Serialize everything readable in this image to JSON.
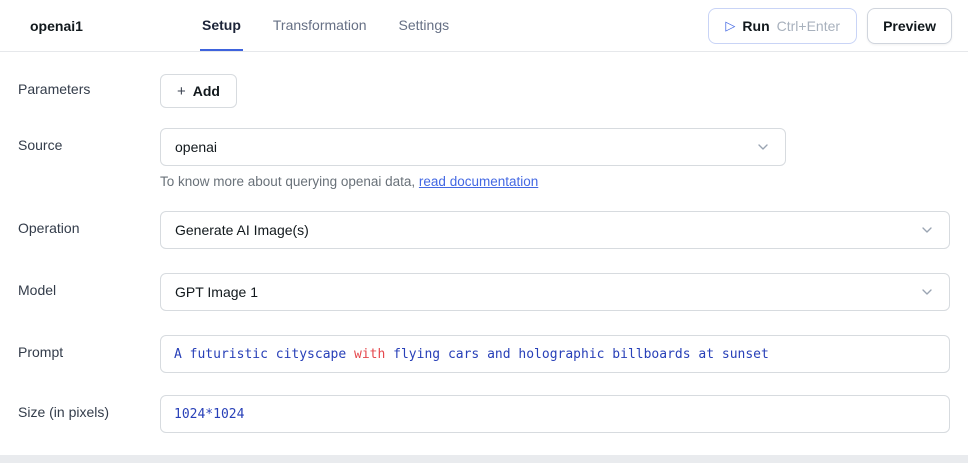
{
  "colors": {
    "accent": "#3e63dd",
    "link": "#4368e3",
    "code_blue": "#2840b8",
    "code_red": "#e5484d"
  },
  "header": {
    "query_name": "openai1",
    "tabs": [
      {
        "label": "Setup",
        "active": true
      },
      {
        "label": "Transformation",
        "active": false
      },
      {
        "label": "Settings",
        "active": false
      }
    ],
    "run_button": {
      "label": "Run",
      "shortcut": "Ctrl+Enter"
    },
    "preview_label": "Preview"
  },
  "form": {
    "parameters": {
      "label": "Parameters",
      "add_label": "Add"
    },
    "source": {
      "label": "Source",
      "value": "openai",
      "helper_prefix": "To know more about querying openai data, ",
      "helper_link": "read documentation"
    },
    "operation": {
      "label": "Operation",
      "value": "Generate AI Image(s)"
    },
    "model": {
      "label": "Model",
      "value": "GPT Image 1"
    },
    "prompt": {
      "label": "Prompt",
      "tokens": [
        {
          "text": "A futuristic cityscape ",
          "color": "blue"
        },
        {
          "text": "with",
          "color": "red"
        },
        {
          "text": " flying cars and holographic billboards at sunset",
          "color": "blue"
        }
      ]
    },
    "size": {
      "label": "Size (in pixels)",
      "value": "1024*1024"
    }
  }
}
